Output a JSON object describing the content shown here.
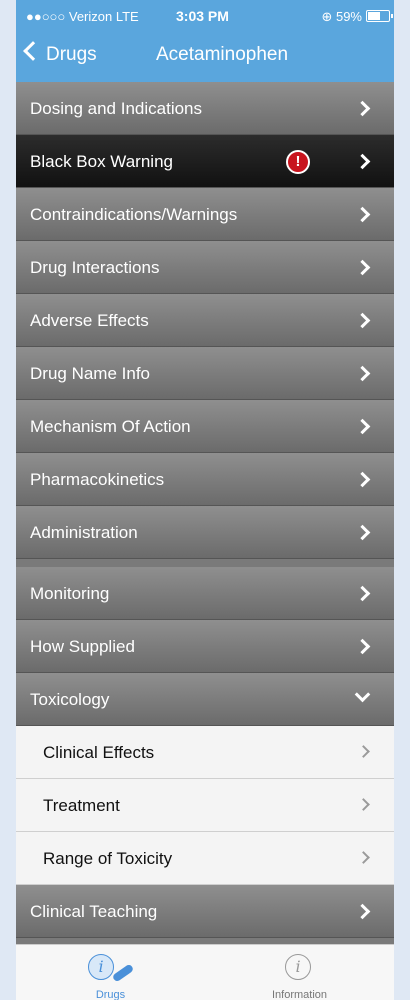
{
  "status_bar": {
    "carrier": "●●○○○ Verizon  LTE",
    "time": "3:03 PM",
    "battery_text": "⊕ 59%",
    "battery_level": 0.59
  },
  "nav": {
    "back_label": "Drugs",
    "title": "Acetaminophen"
  },
  "rows": {
    "dosing": "Dosing and Indications",
    "black_box": "Black Box Warning",
    "contra": "Contraindications/Warnings",
    "interactions": "Drug Interactions",
    "adverse": "Adverse Effects",
    "name_info": "Drug Name Info",
    "mechanism": "Mechanism Of Action",
    "pk": "Pharmacokinetics",
    "administration": "Administration",
    "monitoring": "Monitoring",
    "supplied": "How Supplied",
    "toxicology": "Toxicology",
    "teaching": "Clinical Teaching"
  },
  "toxicology_sub": {
    "clinical_effects": "Clinical Effects",
    "treatment": "Treatment",
    "range": "Range of Toxicity"
  },
  "tabs": {
    "drugs": "Drugs",
    "information": "Information"
  },
  "colors": {
    "nav_blue": "#5aa6dd",
    "warning_red": "#c8141e",
    "tab_active": "#4a90d9"
  }
}
